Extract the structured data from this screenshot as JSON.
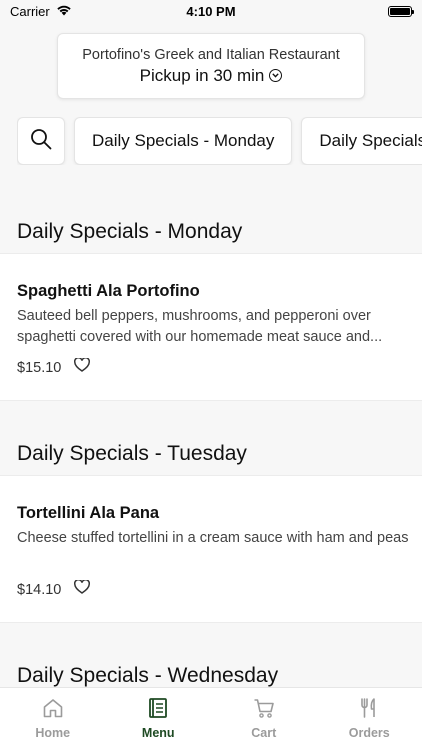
{
  "status_bar": {
    "carrier": "Carrier",
    "time": "4:10 PM"
  },
  "header": {
    "restaurant_name": "Portofino's Greek and Italian Restaurant",
    "pickup_label": "Pickup in 30 min"
  },
  "chips": [
    {
      "label": "Daily Specials - Monday"
    },
    {
      "label": "Daily Specials - Tuesday"
    }
  ],
  "sections": [
    {
      "title": "Daily Specials - Monday",
      "item": {
        "name": "Spaghetti Ala Portofino",
        "description": "Sauteed bell peppers, mushrooms, and pepperoni over spaghetti covered with our homemade meat sauce and...",
        "price": "$15.10"
      }
    },
    {
      "title": "Daily Specials - Tuesday",
      "item": {
        "name": "Tortellini Ala Pana",
        "description": "Cheese stuffed tortellini in a cream sauce with ham and peas",
        "price": "$14.10"
      }
    },
    {
      "title": "Daily Specials - Wednesday"
    }
  ],
  "tabs": [
    {
      "label": "Home",
      "icon": "home-icon"
    },
    {
      "label": "Menu",
      "icon": "menu-icon",
      "active": true
    },
    {
      "label": "Cart",
      "icon": "cart-icon"
    },
    {
      "label": "Orders",
      "icon": "orders-icon"
    }
  ],
  "colors": {
    "accent": "#1e4a23",
    "inactive_tab": "#9b9b9b"
  }
}
